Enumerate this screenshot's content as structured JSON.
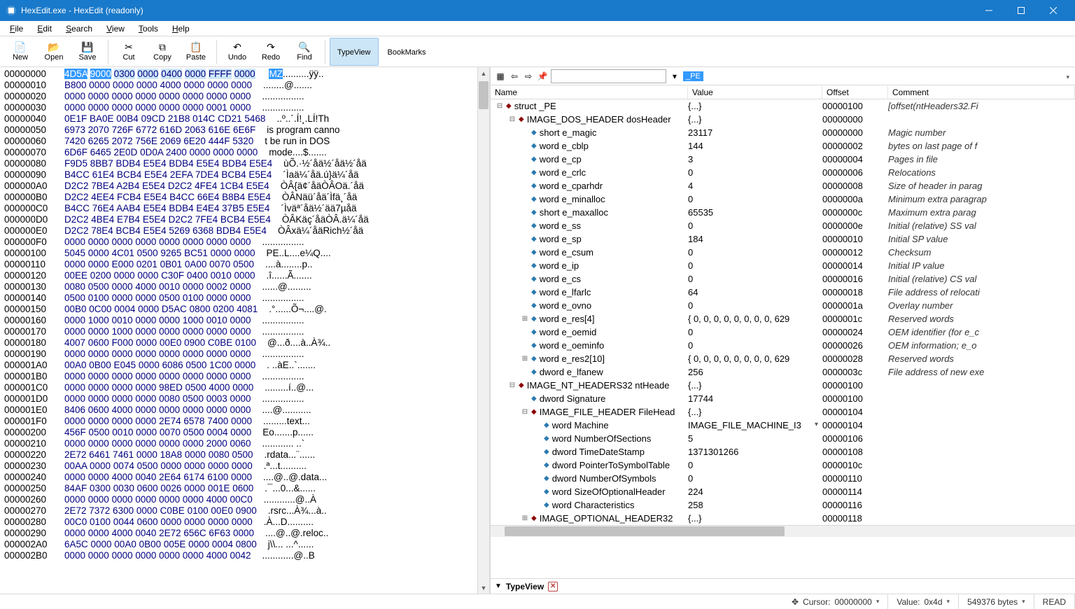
{
  "title": "HexEdit.exe - HexEdit (readonly)",
  "menu": [
    "File",
    "Edit",
    "Search",
    "View",
    "Tools",
    "Help"
  ],
  "toolbar": [
    {
      "icon": "📄",
      "label": "New"
    },
    {
      "icon": "📂",
      "label": "Open"
    },
    {
      "icon": "💾",
      "label": "Save"
    },
    {
      "sep": true
    },
    {
      "icon": "✂",
      "label": "Cut"
    },
    {
      "icon": "⧉",
      "label": "Copy"
    },
    {
      "icon": "📋",
      "label": "Paste"
    },
    {
      "sep": true
    },
    {
      "icon": "↶",
      "label": "Undo"
    },
    {
      "icon": "↷",
      "label": "Redo"
    },
    {
      "icon": "🔍",
      "label": "Find"
    },
    {
      "sep": true
    },
    {
      "icon": "",
      "label": "TypeView",
      "active": true
    },
    {
      "icon": "",
      "label": "BookMarks"
    }
  ],
  "hex": {
    "rows": [
      {
        "addr": "00000000",
        "b": "4D5A 9000 0300 0000 0400 0000 FFFF 0000",
        "a": "MZ..........ÿÿ..",
        "selBytes": 2,
        "hlBytes": 6
      },
      {
        "addr": "00000010",
        "b": "B800 0000 0000 0000 4000 0000 0000 0000",
        "a": "........@......."
      },
      {
        "addr": "00000020",
        "b": "0000 0000 0000 0000 0000 0000 0000 0000",
        "a": "................"
      },
      {
        "addr": "00000030",
        "b": "0000 0000 0000 0000 0000 0000 0001 0000",
        "a": "................"
      },
      {
        "addr": "00000040",
        "b": "0E1F BA0E 00B4 09CD 21B8 014C CD21 5468",
        "a": "..º..´.Í!¸.LÍ!Th"
      },
      {
        "addr": "00000050",
        "b": "6973 2070 726F 6772 616D 2063 616E 6E6F",
        "a": "is program canno"
      },
      {
        "addr": "00000060",
        "b": "7420 6265 2072 756E 2069 6E20 444F 5320",
        "a": "t be run in DOS "
      },
      {
        "addr": "00000070",
        "b": "6D6F 6465 2E0D 0D0A 2400 0000 0000 0000",
        "a": "mode....$......."
      },
      {
        "addr": "00000080",
        "b": "F9D5 8BB7 BDB4 E5E4 BDB4 E5E4 BDB4 E5E4",
        "a": "ùÕ.·½´åä½´åä½´åä"
      },
      {
        "addr": "00000090",
        "b": "B4CC 61E4 BCB4 E5E4 2EFA 7DE4 BCB4 E5E4",
        "a": "´Ìaä¼´åä.ú}ä¼´åä"
      },
      {
        "addr": "000000A0",
        "b": "D2C2 7BE4 A2B4 E5E4 D2C2 4FE4 1CB4 E5E4",
        "a": "ÒÂ{ä¢´åäÒÂOä.´åä"
      },
      {
        "addr": "000000B0",
        "b": "D2C2 4EE4 FCB4 E5E4 B4CC 66E4 B8B4 E5E4",
        "a": "ÒÂNäü´åä´Ìfä¸´åä"
      },
      {
        "addr": "000000C0",
        "b": "B4CC 76E4 AAB4 E5E4 BDB4 E4E4 37B5 E5E4",
        "a": "´Ìväª´åä½´ää7µåä"
      },
      {
        "addr": "000000D0",
        "b": "D2C2 4BE4 E7B4 E5E4 D2C2 7FE4 BCB4 E5E4",
        "a": "ÒÂKäç´åäÒÂ.ä¼´åä"
      },
      {
        "addr": "000000E0",
        "b": "D2C2 78E4 BCB4 E5E4 5269 6368 BDB4 E5E4",
        "a": "ÒÂxä¼´åäRich½´åä"
      },
      {
        "addr": "000000F0",
        "b": "0000 0000 0000 0000 0000 0000 0000 0000",
        "a": "................"
      },
      {
        "addr": "00000100",
        "b": "5045 0000 4C01 0500 9265 BC51 0000 0000",
        "a": "PE..L....e¼Q...."
      },
      {
        "addr": "00000110",
        "b": "0000 0000 E000 0201 0B01 0A00 0070 0500",
        "a": "....à........p.."
      },
      {
        "addr": "00000120",
        "b": "00EE 0200 0000 0000 C30F 0400 0010 0000",
        "a": ".î......Ã......."
      },
      {
        "addr": "00000130",
        "b": "0080 0500 0000 4000 0010 0000 0002 0000",
        "a": "......@........."
      },
      {
        "addr": "00000140",
        "b": "0500 0100 0000 0000 0500 0100 0000 0000",
        "a": "................"
      },
      {
        "addr": "00000150",
        "b": "00B0 0C00 0004 0000 D5AC 0800 0200 4081",
        "a": ".°......Õ¬....@."
      },
      {
        "addr": "00000160",
        "b": "0000 1000 0010 0000 0000 1000 0010 0000",
        "a": "................"
      },
      {
        "addr": "00000170",
        "b": "0000 0000 1000 0000 0000 0000 0000 0000",
        "a": "................"
      },
      {
        "addr": "00000180",
        "b": "4007 0600 F000 0000 00E0 0900 C0BE 0100",
        "a": "@...ð....à..À¾.."
      },
      {
        "addr": "00000190",
        "b": "0000 0000 0000 0000 0000 0000 0000 0000",
        "a": "................"
      },
      {
        "addr": "000001A0",
        "b": "00A0 0B00 E045 0000 6086 0500 1C00 0000",
        "a": ". ..àE..`......."
      },
      {
        "addr": "000001B0",
        "b": "0000 0000 0000 0000 0000 0000 0000 0000",
        "a": "................"
      },
      {
        "addr": "000001C0",
        "b": "0000 0000 0000 0000 98ED 0500 4000 0000",
        "a": ".........í..@..."
      },
      {
        "addr": "000001D0",
        "b": "0000 0000 0000 0000 0080 0500 0003 0000",
        "a": "................"
      },
      {
        "addr": "000001E0",
        "b": "8406 0600 4000 0000 0000 0000 0000 0000",
        "a": "....@..........."
      },
      {
        "addr": "000001F0",
        "b": "0000 0000 0000 0000 2E74 6578 7400 0000",
        "a": ".........text..."
      },
      {
        "addr": "00000200",
        "b": "456F 0500 0010 0000 0070 0500 0004 0000",
        "a": "Eo.......p......"
      },
      {
        "addr": "00000210",
        "b": "0000 0000 0000 0000 0000 0000 2000 0060",
        "a": "............ ..`"
      },
      {
        "addr": "00000220",
        "b": "2E72 6461 7461 0000 18A8 0000 0080 0500",
        "a": ".rdata...¨......"
      },
      {
        "addr": "00000230",
        "b": "00AA 0000 0074 0500 0000 0000 0000 0000",
        "a": ".ª...t.........."
      },
      {
        "addr": "00000240",
        "b": "0000 0000 4000 0040 2E64 6174 6100 0000",
        "a": "....@..@.data..."
      },
      {
        "addr": "00000250",
        "b": "84AF 0300 0030 0600 0026 0000 001E 0600",
        "a": ".¯...0...&......"
      },
      {
        "addr": "00000260",
        "b": "0000 0000 0000 0000 0000 0000 4000 00C0",
        "a": "............@..À"
      },
      {
        "addr": "00000270",
        "b": "2E72 7372 6300 0000 C0BE 0100 00E0 0900",
        "a": ".rsrc...À¾...à.."
      },
      {
        "addr": "00000280",
        "b": "00C0 0100 0044 0600 0000 0000 0000 0000",
        "a": ".À...D.........."
      },
      {
        "addr": "00000290",
        "b": "0000 0000 4000 0040 2E72 656C 6F63 0000",
        "a": "....@..@.reloc.."
      },
      {
        "addr": "000002A0",
        "b": "6A5C 0000 00A0 0B00 005E 0000 0004 0800",
        "a": "j\\\\... ...^......"
      },
      {
        "addr": "000002B0",
        "b": "0000 0000 0000 0000 0000 0000 4000 0042",
        "a": "............@..B"
      }
    ]
  },
  "typeview": {
    "selected_type": "_PE",
    "columns": [
      "Name",
      "Value",
      "Offset",
      "Comment"
    ],
    "rows": [
      {
        "depth": 0,
        "exp": "-",
        "kind": "struct",
        "name": "struct _PE",
        "value": "{...}",
        "offset": "00000100",
        "comment": "[offset(ntHeaders32.Fi"
      },
      {
        "depth": 1,
        "exp": "-",
        "kind": "struct",
        "name": "IMAGE_DOS_HEADER dosHeader",
        "value": "{...}",
        "offset": "00000000",
        "comment": ""
      },
      {
        "depth": 2,
        "exp": "",
        "kind": "field",
        "name": "short e_magic",
        "value": "23117",
        "offset": "00000000",
        "comment": "Magic number"
      },
      {
        "depth": 2,
        "exp": "",
        "kind": "field",
        "name": "word e_cblp",
        "value": "144",
        "offset": "00000002",
        "comment": "bytes on last page of f"
      },
      {
        "depth": 2,
        "exp": "",
        "kind": "field",
        "name": "word e_cp",
        "value": "3",
        "offset": "00000004",
        "comment": "Pages in file"
      },
      {
        "depth": 2,
        "exp": "",
        "kind": "field",
        "name": "word e_crlc",
        "value": "0",
        "offset": "00000006",
        "comment": "Relocations"
      },
      {
        "depth": 2,
        "exp": "",
        "kind": "field",
        "name": "word e_cparhdr",
        "value": "4",
        "offset": "00000008",
        "comment": "Size of header in parag"
      },
      {
        "depth": 2,
        "exp": "",
        "kind": "field",
        "name": "word e_minalloc",
        "value": "0",
        "offset": "0000000a",
        "comment": "Minimum extra paragrap"
      },
      {
        "depth": 2,
        "exp": "",
        "kind": "field",
        "name": "short e_maxalloc",
        "value": "65535",
        "offset": "0000000c",
        "comment": "Maximum extra parag"
      },
      {
        "depth": 2,
        "exp": "",
        "kind": "field",
        "name": "word e_ss",
        "value": "0",
        "offset": "0000000e",
        "comment": "Initial (relative) SS val"
      },
      {
        "depth": 2,
        "exp": "",
        "kind": "field",
        "name": "word e_sp",
        "value": "184",
        "offset": "00000010",
        "comment": "Initial SP value"
      },
      {
        "depth": 2,
        "exp": "",
        "kind": "field",
        "name": "word e_csum",
        "value": "0",
        "offset": "00000012",
        "comment": "Checksum"
      },
      {
        "depth": 2,
        "exp": "",
        "kind": "field",
        "name": "word e_ip",
        "value": "0",
        "offset": "00000014",
        "comment": "Initial IP value"
      },
      {
        "depth": 2,
        "exp": "",
        "kind": "field",
        "name": "word e_cs",
        "value": "0",
        "offset": "00000016",
        "comment": "Initial (relative) CS val"
      },
      {
        "depth": 2,
        "exp": "",
        "kind": "field",
        "name": "word e_lfarlc",
        "value": "64",
        "offset": "00000018",
        "comment": "File address of relocati"
      },
      {
        "depth": 2,
        "exp": "",
        "kind": "field",
        "name": "word e_ovno",
        "value": "0",
        "offset": "0000001a",
        "comment": "Overlay number"
      },
      {
        "depth": 2,
        "exp": "+",
        "kind": "field",
        "name": "word e_res[4]",
        "value": "{ 0, 0, 0, 0, 0, 0, 0, 0, 629",
        "offset": "0000001c",
        "comment": "Reserved words"
      },
      {
        "depth": 2,
        "exp": "",
        "kind": "field",
        "name": "word e_oemid",
        "value": "0",
        "offset": "00000024",
        "comment": "OEM identifier (for e_c"
      },
      {
        "depth": 2,
        "exp": "",
        "kind": "field",
        "name": "word e_oeminfo",
        "value": "0",
        "offset": "00000026",
        "comment": "OEM information; e_o"
      },
      {
        "depth": 2,
        "exp": "+",
        "kind": "field",
        "name": "word e_res2[10]",
        "value": "{ 0, 0, 0, 0, 0, 0, 0, 0, 629",
        "offset": "00000028",
        "comment": "Reserved words"
      },
      {
        "depth": 2,
        "exp": "",
        "kind": "field",
        "name": "dword e_lfanew",
        "value": "256",
        "offset": "0000003c",
        "comment": "File address of new exe"
      },
      {
        "depth": 1,
        "exp": "-",
        "kind": "struct",
        "name": "IMAGE_NT_HEADERS32 ntHeade",
        "value": "{...}",
        "offset": "00000100",
        "comment": ""
      },
      {
        "depth": 2,
        "exp": "",
        "kind": "field",
        "name": "dword Signature",
        "value": "17744",
        "offset": "00000100",
        "comment": ""
      },
      {
        "depth": 2,
        "exp": "-",
        "kind": "struct",
        "name": "IMAGE_FILE_HEADER FileHead",
        "value": "{...}",
        "offset": "00000104",
        "comment": ""
      },
      {
        "depth": 3,
        "exp": "",
        "kind": "field",
        "name": "word Machine",
        "value": "IMAGE_FILE_MACHINE_I3",
        "offset": "00000104",
        "comment": "",
        "combo": true
      },
      {
        "depth": 3,
        "exp": "",
        "kind": "field",
        "name": "word NumberOfSections",
        "value": "5",
        "offset": "00000106",
        "comment": ""
      },
      {
        "depth": 3,
        "exp": "",
        "kind": "field",
        "name": "dword TimeDateStamp",
        "value": "1371301266",
        "offset": "00000108",
        "comment": ""
      },
      {
        "depth": 3,
        "exp": "",
        "kind": "field",
        "name": "dword PointerToSymbolTable",
        "value": "0",
        "offset": "0000010c",
        "comment": ""
      },
      {
        "depth": 3,
        "exp": "",
        "kind": "field",
        "name": "dword NumberOfSymbols",
        "value": "0",
        "offset": "00000110",
        "comment": ""
      },
      {
        "depth": 3,
        "exp": "",
        "kind": "field",
        "name": "word SizeOfOptionalHeader",
        "value": "224",
        "offset": "00000114",
        "comment": ""
      },
      {
        "depth": 3,
        "exp": "",
        "kind": "field",
        "name": "word Characteristics",
        "value": "258",
        "offset": "00000116",
        "comment": ""
      },
      {
        "depth": 2,
        "exp": "+",
        "kind": "struct",
        "name": "IMAGE_OPTIONAL_HEADER32",
        "value": "{...}",
        "offset": "00000118",
        "comment": ""
      }
    ]
  },
  "paneltab": {
    "label": "TypeView"
  },
  "status": {
    "cursor_label": "Cursor:",
    "cursor": "00000000",
    "value_label": "Value:",
    "value": "0x4d",
    "size": "549376 bytes",
    "mode": "READ"
  }
}
